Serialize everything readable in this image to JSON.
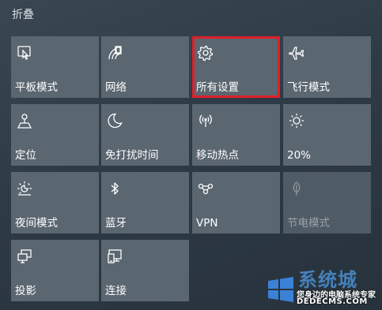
{
  "header": {
    "collapse_label": "折叠"
  },
  "tiles": [
    {
      "label": "平板模式",
      "icon": "tablet-mode-icon",
      "enabled": true
    },
    {
      "label": "网络",
      "icon": "network-icon",
      "enabled": true
    },
    {
      "label": "所有设置",
      "icon": "settings-gear-icon",
      "enabled": true,
      "highlighted": true
    },
    {
      "label": "飞行模式",
      "icon": "airplane-icon",
      "enabled": true
    },
    {
      "label": "定位",
      "icon": "location-icon",
      "enabled": true
    },
    {
      "label": "免打扰时间",
      "icon": "moon-icon",
      "enabled": true
    },
    {
      "label": "移动热点",
      "icon": "mobile-hotspot-icon",
      "enabled": true
    },
    {
      "label": "20%",
      "icon": "brightness-icon",
      "enabled": true
    },
    {
      "label": "夜间模式",
      "icon": "night-light-icon",
      "enabled": true
    },
    {
      "label": "蓝牙",
      "icon": "bluetooth-icon",
      "enabled": true
    },
    {
      "label": "VPN",
      "icon": "vpn-icon",
      "enabled": true
    },
    {
      "label": "节电模式",
      "icon": "battery-saver-icon",
      "enabled": false
    },
    {
      "label": "投影",
      "icon": "project-icon",
      "enabled": true
    },
    {
      "label": "连接",
      "icon": "connect-icon",
      "enabled": true
    }
  ],
  "watermark": {
    "brand": "系统城",
    "subtitle": "您身边的电脑系统专家",
    "url": "DEDECMS.COM"
  },
  "colors": {
    "tile": "#5a6670",
    "tile_disabled": "#4f5b65",
    "highlight_border": "#e0202a",
    "background": "#2e3a45"
  }
}
